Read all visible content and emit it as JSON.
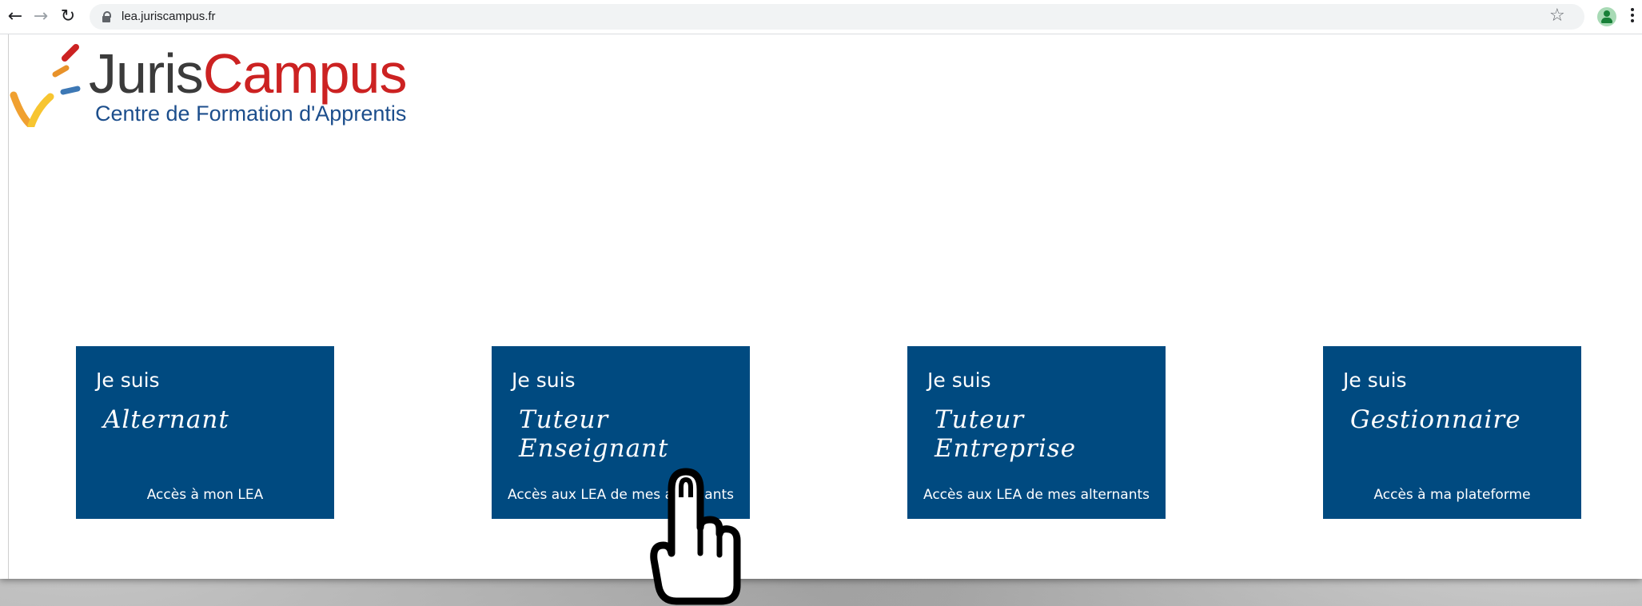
{
  "browser": {
    "url": "lea.juriscampus.fr",
    "back_icon": "arrow-left-icon",
    "forward_icon": "arrow-right-icon",
    "reload_icon": "reload-icon"
  },
  "logo": {
    "name_part1": "Juris",
    "name_part2": "Campus",
    "tagline": "Centre de Formation d'Apprentis",
    "colors": {
      "juris": "#3b3b3b",
      "campus": "#cc2222",
      "tagline": "#1c4e8c"
    }
  },
  "cards": [
    {
      "title": "Je suis",
      "role": "Alternant",
      "link": "Accès à mon LEA"
    },
    {
      "title": "Je suis",
      "role": "Tuteur Enseignant",
      "link": "Accès aux LEA de mes alternants"
    },
    {
      "title": "Je suis",
      "role": "Tuteur Entreprise",
      "link": "Accès aux LEA de mes alternants"
    },
    {
      "title": "Je suis",
      "role": "Gestionnaire",
      "link": "Accès à ma plateforme"
    }
  ],
  "theme": {
    "card_bg": "#004a80",
    "card_text": "#ffffff"
  },
  "cursor": {
    "icon": "hand-pointer-icon"
  }
}
